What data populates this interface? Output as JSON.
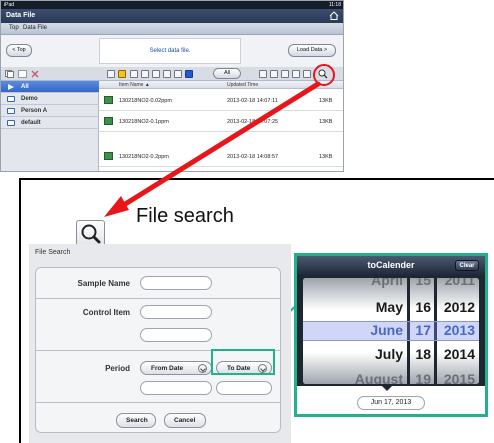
{
  "ipad": {
    "status_left": "iPad",
    "status_right": "11:18",
    "window_title": "Data File",
    "breadcrumbs": [
      "Top",
      "Data File"
    ],
    "nav_back_label": "< Top",
    "nav_message": "Select data file.",
    "load_button_label": "Load Data >",
    "folders": [
      {
        "label": "All",
        "selected": true
      },
      {
        "label": "Demo",
        "selected": false
      },
      {
        "label": "Person A",
        "selected": false
      },
      {
        "label": "default",
        "selected": false
      }
    ],
    "filter_label": "All",
    "columns": {
      "name": "Item Name ▲",
      "updated": "Updated Time"
    },
    "files": [
      {
        "name": "130218NO2-0.02ppm",
        "updated": "2013-02-18 14:07:11",
        "size": "13KB"
      },
      {
        "name": "130218NO2-0.1ppm",
        "updated": "2013-02-18 14:07:25",
        "size": "13KB"
      },
      {
        "name": "130218NO2-0.2ppm",
        "updated": "2013-02-18 14:08:57",
        "size": "13KB"
      }
    ]
  },
  "callout": {
    "caption": "File search",
    "accent_red": "#e8151b",
    "accent_teal": "#1fb28d"
  },
  "file_search": {
    "title": "File Search",
    "sample_name_label": "Sample Name",
    "control_item_label": "Control Item",
    "period_label": "Period",
    "from_date_label": "From Date",
    "to_date_label": "To Date",
    "search_button": "Search",
    "cancel_button": "Cancel"
  },
  "calendar": {
    "title": "toCalender",
    "clear_button": "Clear",
    "months": [
      "April",
      "May",
      "June",
      "July",
      "August"
    ],
    "days": [
      "15",
      "16",
      "17",
      "18",
      "19"
    ],
    "years": [
      "2011",
      "2012",
      "2013",
      "2014",
      "2015"
    ],
    "selected_index": 2,
    "selected_date": "Jun 17, 2013"
  }
}
